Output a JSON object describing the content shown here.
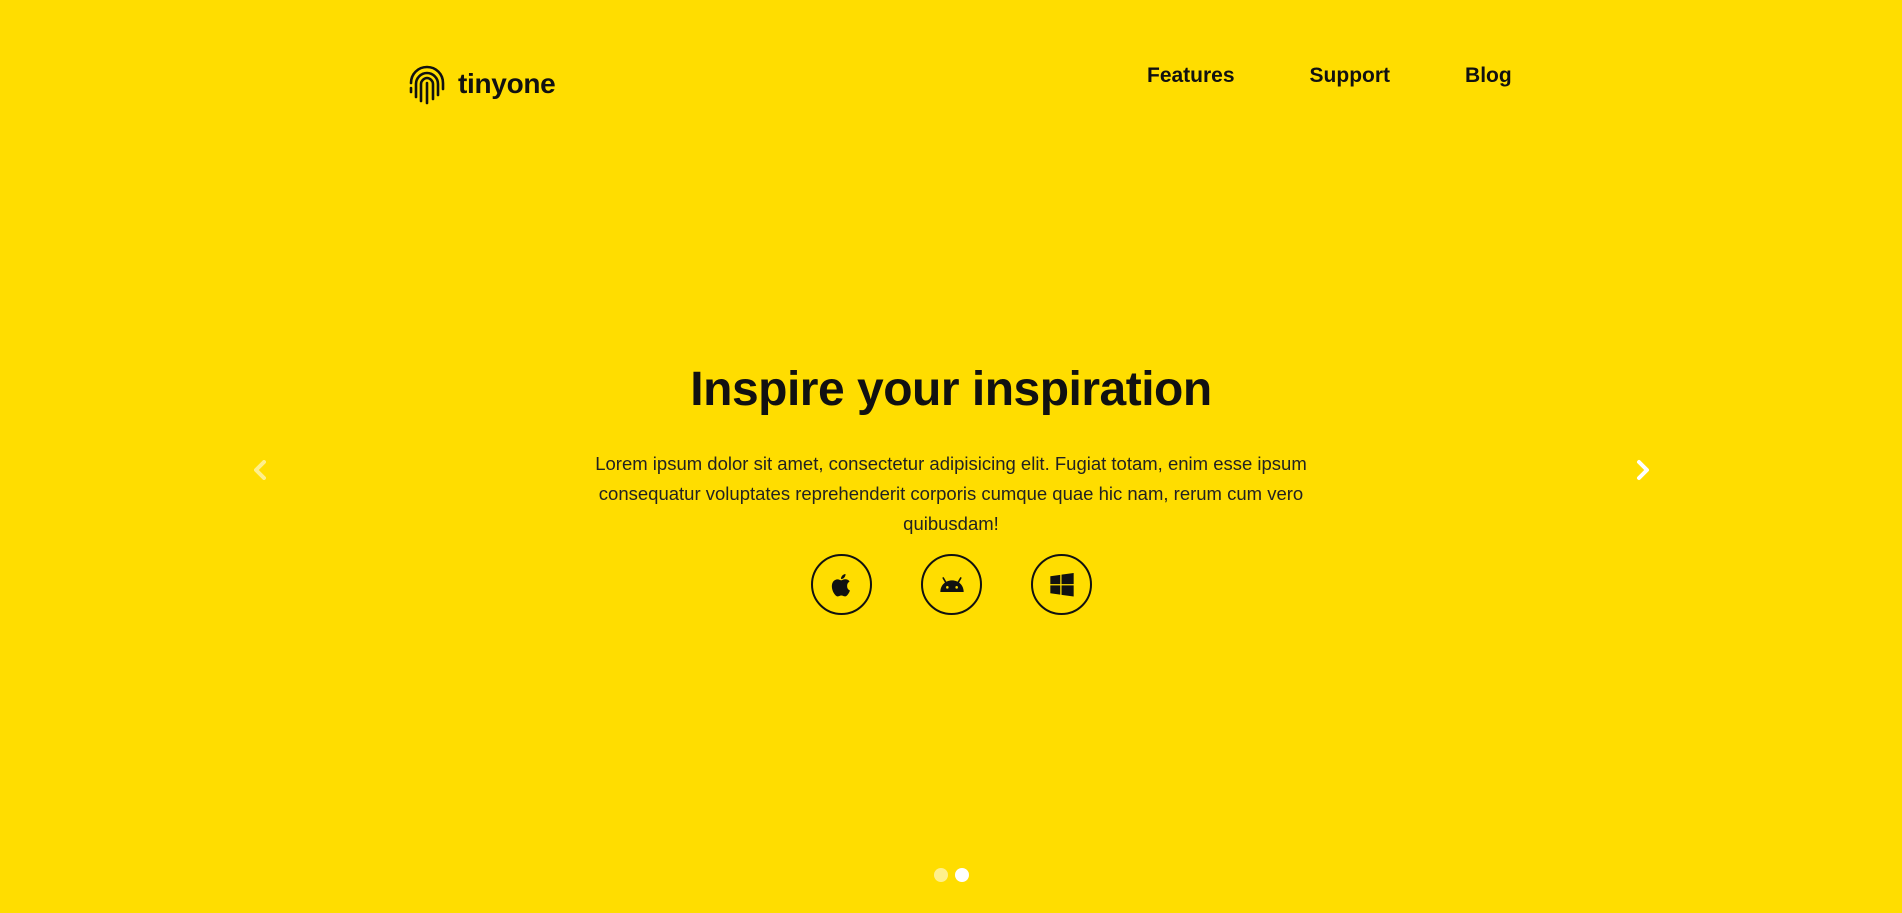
{
  "brand": {
    "name": "tinyone",
    "logo_icon": "fingerprint-icon"
  },
  "nav": {
    "items": [
      {
        "label": "Features"
      },
      {
        "label": "Support"
      },
      {
        "label": "Blog"
      }
    ]
  },
  "hero": {
    "title": "Inspire your inspiration",
    "description": "Lorem ipsum dolor sit amet, consectetur adipisicing elit. Fugiat totam, enim esse ipsum consequatur voluptates reprehenderit corporis cumque quae hic nam, rerum cum vero quibusdam!",
    "platforms": [
      {
        "icon": "apple-icon"
      },
      {
        "icon": "android-icon"
      },
      {
        "icon": "windows-icon"
      }
    ]
  },
  "carousel": {
    "slide_count": 2,
    "active_slide": 2,
    "prev_icon": "chevron-left-icon",
    "next_icon": "chevron-right-icon"
  },
  "colors": {
    "background": "#FFDD00",
    "text": "#111111",
    "indicator_active": "#FFFFFF"
  }
}
